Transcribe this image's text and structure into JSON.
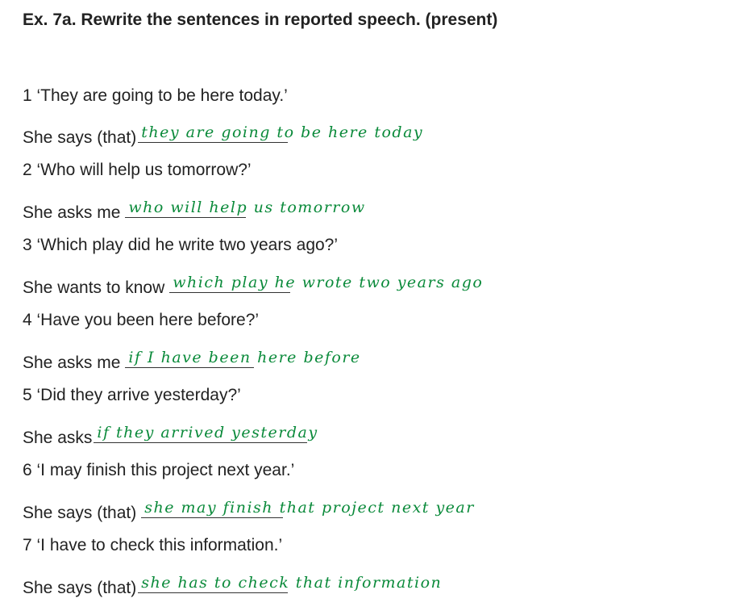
{
  "exercise": {
    "title": "Ex. 7a. Rewrite the sentences in reported speech. (present)"
  },
  "items": [
    {
      "quote": "1 ‘They are going to be here today.’",
      "prompt": "She says (that)",
      "answer": "they are going to be here today"
    },
    {
      "quote": "2 ‘Who will help us tomorrow?’",
      "prompt": "She asks me",
      "answer": "who will help us tomorrow"
    },
    {
      "quote": "3 ‘Which play did he write two years ago?’",
      "prompt": "She wants to know",
      "answer": "which play he wrote two years ago"
    },
    {
      "quote": "4 ‘Have you been here before?’",
      "prompt": "She asks me",
      "answer": "if I have been here before"
    },
    {
      "quote": "5 ‘Did they arrive yesterday?’",
      "prompt": "She asks",
      "answer": "if they arrived yesterday"
    },
    {
      "quote": "6 ‘I may finish this project next year.’",
      "prompt": "She says (that)",
      "answer": "she may finish that project next year"
    },
    {
      "quote": "7 ‘I have to check this information.’",
      "prompt": "She says (that)",
      "answer": "she has to check that information"
    }
  ],
  "colors": {
    "handwriting": "#0a8a3a",
    "text": "#222222"
  }
}
